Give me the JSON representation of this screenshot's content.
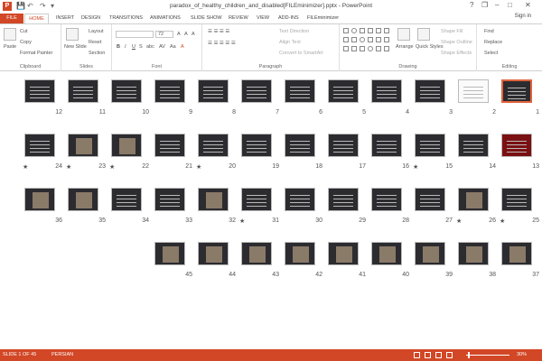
{
  "app": {
    "title": "paradox_of_healthy_children_and_disabled[FILEminimizer].pptx - PowerPoint",
    "sign_in": "Sign in"
  },
  "window": {
    "help": "?",
    "restore": "❐",
    "minimize": "–",
    "maximize": "□",
    "close": "✕"
  },
  "quick_access": {
    "logo": "P",
    "save": "💾",
    "undo": "↶",
    "redo": "↷",
    "customize": "▾"
  },
  "tabs": [
    "FILE",
    "HOME",
    "INSERT",
    "DESIGN",
    "TRANSITIONS",
    "ANIMATIONS",
    "SLIDE SHOW",
    "REVIEW",
    "VIEW",
    "ADD-INS",
    "FILEminimizer"
  ],
  "ribbon": {
    "clipboard": {
      "label": "Clipboard",
      "paste": "Paste",
      "cut": "Cut",
      "copy": "Copy",
      "format_painter": "Format Painter"
    },
    "slides": {
      "label": "Slides",
      "new_slide": "New Slide",
      "layout": "Layout",
      "reset": "Reset",
      "section": "Section"
    },
    "font": {
      "label": "Font",
      "size": "72",
      "bold": "B",
      "italic": "I",
      "underline": "U",
      "strike": "S",
      "shadow": "abc",
      "spacing": "AV",
      "case": "Aa",
      "color": "A",
      "grow": "A",
      "shrink": "A",
      "clear": "A"
    },
    "paragraph": {
      "label": "Paragraph",
      "text_direction": "Text Direction",
      "align_text": "Align Text",
      "convert": "Convert to SmartArt"
    },
    "drawing": {
      "label": "Drawing",
      "arrange": "Arrange",
      "quick_styles": "Quick Styles",
      "fill": "Shape Fill",
      "outline": "Shape Outline",
      "effects": "Shape Effects"
    },
    "editing": {
      "label": "Editing",
      "find": "Find",
      "replace": "Replace",
      "select": "Select"
    }
  },
  "slides": [
    {
      "n": "12",
      "star": false,
      "t": "dark"
    },
    {
      "n": "11",
      "star": false,
      "t": "dark"
    },
    {
      "n": "10",
      "star": false,
      "t": "dark"
    },
    {
      "n": "9",
      "star": false,
      "t": "dark"
    },
    {
      "n": "8",
      "star": false,
      "t": "dark"
    },
    {
      "n": "7",
      "star": false,
      "t": "dark"
    },
    {
      "n": "6",
      "star": false,
      "t": "dark"
    },
    {
      "n": "5",
      "star": false,
      "t": "dark"
    },
    {
      "n": "4",
      "star": false,
      "t": "dark"
    },
    {
      "n": "3",
      "star": false,
      "t": "dark"
    },
    {
      "n": "2",
      "star": false,
      "t": "light"
    },
    {
      "n": "1",
      "star": false,
      "t": "dark",
      "sel": true
    },
    {
      "n": "24",
      "star": true,
      "t": "dark"
    },
    {
      "n": "23",
      "star": true,
      "t": "photo"
    },
    {
      "n": "22",
      "star": true,
      "t": "photo"
    },
    {
      "n": "21",
      "star": false,
      "t": "dark"
    },
    {
      "n": "20",
      "star": true,
      "t": "dark"
    },
    {
      "n": "19",
      "star": false,
      "t": "dark"
    },
    {
      "n": "18",
      "star": false,
      "t": "dark"
    },
    {
      "n": "17",
      "star": false,
      "t": "dark"
    },
    {
      "n": "16",
      "star": false,
      "t": "dark"
    },
    {
      "n": "15",
      "star": true,
      "t": "dark"
    },
    {
      "n": "14",
      "star": false,
      "t": "dark"
    },
    {
      "n": "13",
      "star": false,
      "t": "red"
    },
    {
      "n": "36",
      "star": false,
      "t": "photo"
    },
    {
      "n": "35",
      "star": false,
      "t": "photo"
    },
    {
      "n": "34",
      "star": false,
      "t": "dark"
    },
    {
      "n": "33",
      "star": false,
      "t": "dark"
    },
    {
      "n": "32",
      "star": false,
      "t": "photo"
    },
    {
      "n": "31",
      "star": true,
      "t": "dark"
    },
    {
      "n": "30",
      "star": false,
      "t": "dark"
    },
    {
      "n": "29",
      "star": false,
      "t": "dark"
    },
    {
      "n": "28",
      "star": false,
      "t": "dark"
    },
    {
      "n": "27",
      "star": false,
      "t": "dark"
    },
    {
      "n": "26",
      "star": true,
      "t": "photo"
    },
    {
      "n": "25",
      "star": true,
      "t": "dark"
    },
    {
      "n": "45",
      "star": false,
      "t": "photo"
    },
    {
      "n": "44",
      "star": false,
      "t": "photo"
    },
    {
      "n": "43",
      "star": false,
      "t": "photo"
    },
    {
      "n": "42",
      "star": false,
      "t": "photo"
    },
    {
      "n": "41",
      "star": false,
      "t": "photo"
    },
    {
      "n": "40",
      "star": false,
      "t": "photo"
    },
    {
      "n": "39",
      "star": false,
      "t": "photo"
    },
    {
      "n": "38",
      "star": false,
      "t": "photo"
    },
    {
      "n": "37",
      "star": false,
      "t": "photo"
    }
  ],
  "star_glyph": "★",
  "status": {
    "slide": "SLIDE 1 OF 45",
    "language": "PERSIAN",
    "zoom": "30%",
    "zoom_level": 30
  },
  "colors": {
    "accent": "#d24726"
  }
}
